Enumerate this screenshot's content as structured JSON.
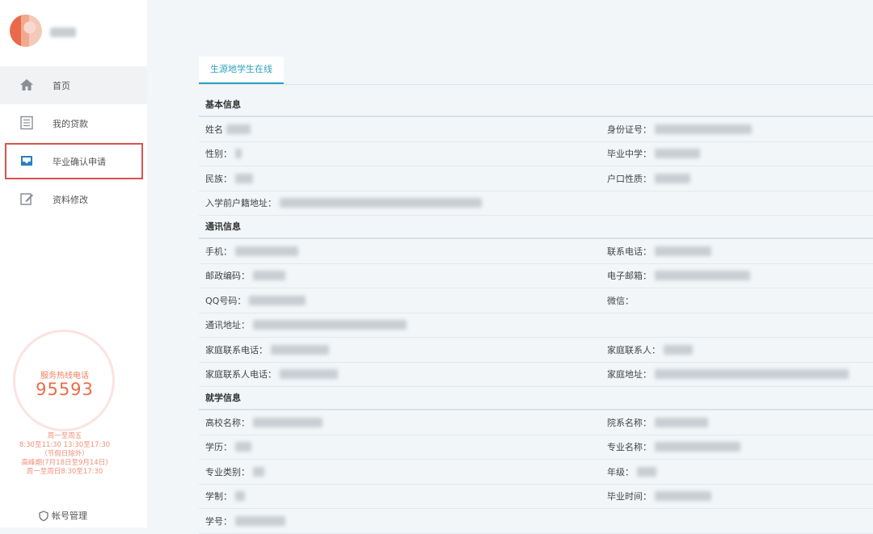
{
  "sidebar": {
    "username": "用户",
    "nav": [
      {
        "label": "首页",
        "icon": "home-icon"
      },
      {
        "label": "我的贷款",
        "icon": "list-icon"
      },
      {
        "label": "毕业确认申请",
        "icon": "inbox-icon"
      },
      {
        "label": "资料修改",
        "icon": "edit-icon"
      }
    ],
    "hotline_title": "服务热线电话",
    "hotline_number": "95593",
    "hours_1": "周一至周五",
    "hours_2": "8:30至11:30 13:30至17:30",
    "hours_3": "（节假日除外）",
    "hours_4": "高峰期(7月18日至9月14日)",
    "hours_5": "周一至周日8:30至17:30",
    "account_label": "帐号管理"
  },
  "main": {
    "tab_label": "生源地学生在线",
    "sections": {
      "basic": "基本信息",
      "contact": "通讯信息",
      "school": "就学信息"
    },
    "fields": {
      "name": "姓名",
      "id_card": "身份证号：",
      "gender": "性别：",
      "high_school": "毕业中学：",
      "ethnicity": "民族：",
      "hukou_type": "户口性质：",
      "pre_enroll_address": "入学前户籍地址：",
      "mobile": "手机：",
      "phone": "联系电话：",
      "postcode": "邮政编码：",
      "email": "电子邮箱：",
      "qq": "QQ号码：",
      "wechat": "微信：",
      "address": "通讯地址：",
      "family_phone": "家庭联系电话：",
      "family_contact": "家庭联系人：",
      "family_contact_phone": "家庭联系人电话：",
      "family_address": "家庭地址：",
      "university": "高校名称：",
      "department": "院系名称：",
      "degree": "学历：",
      "major": "专业名称：",
      "major_category": "专业类别：",
      "grade": "年级：",
      "duration": "学制：",
      "graduation_time": "毕业时间：",
      "student_id": "学号："
    }
  }
}
